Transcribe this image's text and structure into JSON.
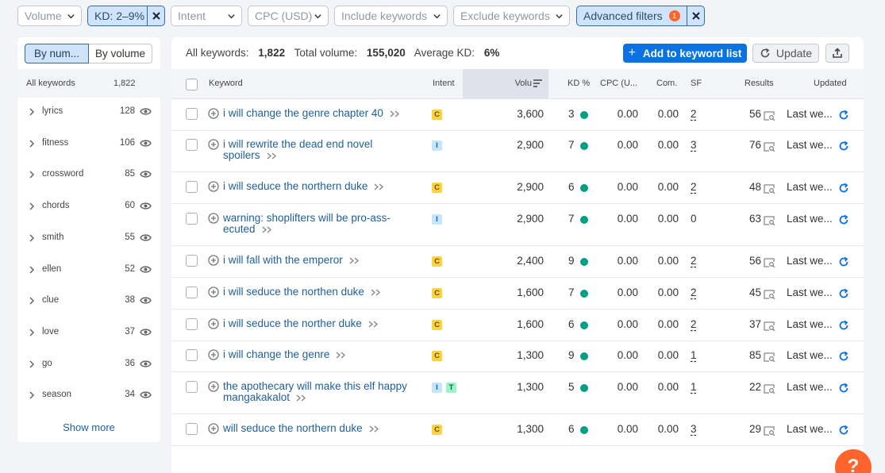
{
  "filters": {
    "volume": "Volume",
    "kd": "KD: 2–9%",
    "intent": "Intent",
    "cpc": "CPC (USD)",
    "include": "Include keywords",
    "exclude": "Exclude keywords",
    "advanced": "Advanced filters",
    "advanced_count": "1"
  },
  "sidebar": {
    "tab_by_number": "By num...",
    "tab_by_volume": "By volume",
    "header_label": "All keywords",
    "header_count": "1,822",
    "groups": [
      {
        "label": "lyrics",
        "count": "128"
      },
      {
        "label": "fitness",
        "count": "106"
      },
      {
        "label": "crossword",
        "count": "85"
      },
      {
        "label": "chords",
        "count": "60"
      },
      {
        "label": "smith",
        "count": "55"
      },
      {
        "label": "ellen",
        "count": "52"
      },
      {
        "label": "clue",
        "count": "38"
      },
      {
        "label": "love",
        "count": "37"
      },
      {
        "label": "go",
        "count": "36"
      },
      {
        "label": "season",
        "count": "34"
      }
    ],
    "show_more": "Show more"
  },
  "summary": {
    "all_keywords_label": "All keywords:",
    "all_keywords_value": "1,822",
    "total_volume_label": "Total volume:",
    "total_volume_value": "155,020",
    "avg_kd_label": "Average KD:",
    "avg_kd_value": "6%"
  },
  "toolbar": {
    "add_label": "Add to keyword list",
    "update_label": "Update"
  },
  "columns": {
    "keyword": "Keyword",
    "intent": "Intent",
    "volume": "Volu",
    "kd": "KD %",
    "cpc": "CPC (U...",
    "com": "Com.",
    "sf": "SF",
    "results": "Results",
    "updated": "Updated"
  },
  "rows": [
    {
      "kw1": "i will change the genre chapter 40",
      "kw2": "",
      "intent": [
        "C"
      ],
      "volume": "3,600",
      "kd": "3",
      "cpc": "0.00",
      "com": "0.00",
      "sf": "2",
      "results": "56",
      "updated": "Last we..."
    },
    {
      "kw1": "i will rewrite the dead end novel",
      "kw2": "spoilers",
      "intent": [
        "I"
      ],
      "volume": "2,900",
      "kd": "7",
      "cpc": "0.00",
      "com": "0.00",
      "sf": "3",
      "results": "76",
      "updated": "Last we..."
    },
    {
      "kw1": "i will seduce the northern duke",
      "kw2": "",
      "intent": [
        "C"
      ],
      "volume": "2,900",
      "kd": "6",
      "cpc": "0.00",
      "com": "0.00",
      "sf": "2",
      "results": "48",
      "updated": "Last we..."
    },
    {
      "kw1": "warning: shoplifters will be pro-ass-",
      "kw2": "ecuted",
      "intent": [
        "I"
      ],
      "volume": "2,900",
      "kd": "7",
      "cpc": "0.00",
      "com": "0.00",
      "sf": "0",
      "results": "63",
      "updated": "Last we..."
    },
    {
      "kw1": "i will fall with the emperor",
      "kw2": "",
      "intent": [
        "C"
      ],
      "volume": "2,400",
      "kd": "9",
      "cpc": "0.00",
      "com": "0.00",
      "sf": "2",
      "results": "56",
      "updated": "Last we..."
    },
    {
      "kw1": "i will seduce the northen duke",
      "kw2": "",
      "intent": [
        "C"
      ],
      "volume": "1,600",
      "kd": "7",
      "cpc": "0.00",
      "com": "0.00",
      "sf": "2",
      "results": "45",
      "updated": "Last we..."
    },
    {
      "kw1": "i will seduce the norther duke",
      "kw2": "",
      "intent": [
        "C"
      ],
      "volume": "1,600",
      "kd": "6",
      "cpc": "0.00",
      "com": "0.00",
      "sf": "2",
      "results": "37",
      "updated": "Last we..."
    },
    {
      "kw1": "i will change the genre",
      "kw2": "",
      "intent": [
        "C"
      ],
      "volume": "1,300",
      "kd": "9",
      "cpc": "0.00",
      "com": "0.00",
      "sf": "1",
      "results": "85",
      "updated": "Last we..."
    },
    {
      "kw1": "the apothecary will make this elf happy",
      "kw2": "mangakakalot",
      "intent": [
        "I",
        "T"
      ],
      "volume": "1,300",
      "kd": "5",
      "cpc": "0.00",
      "com": "0.00",
      "sf": "1",
      "results": "22",
      "updated": "Last we..."
    },
    {
      "kw1": "will seduce the northern duke",
      "kw2": "",
      "intent": [
        "C"
      ],
      "volume": "1,300",
      "kd": "6",
      "cpc": "0.00",
      "com": "0.00",
      "sf": "3",
      "results": "29",
      "updated": "Last we..."
    }
  ],
  "colors": {
    "accent": "#0a72e3",
    "link": "#1f5f9a",
    "kd_easy": "#009f81",
    "orange": "#ff642d"
  },
  "help": "?"
}
